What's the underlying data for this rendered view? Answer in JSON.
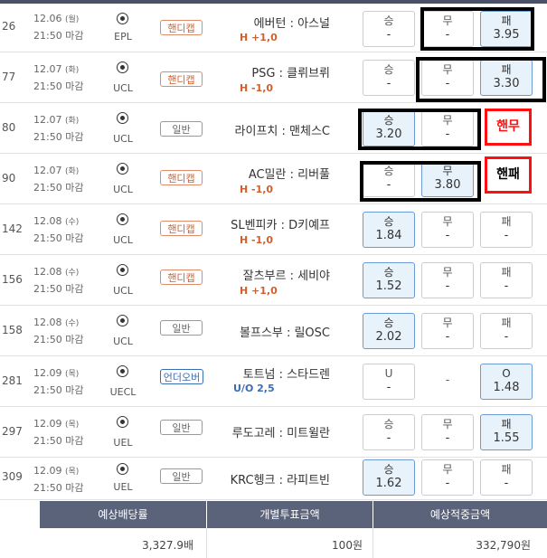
{
  "rows": [
    {
      "num": "26",
      "date": "12.06",
      "day": "(월)",
      "time": "21:50 마감",
      "league": "EPL",
      "type": "핸디캡",
      "match": "에버턴 : 아스널",
      "sub": "H +1,0",
      "odds": [
        {
          "label": "승",
          "value": "-"
        },
        {
          "label": "무",
          "value": "-"
        },
        {
          "label": "패",
          "value": "3.95"
        }
      ]
    },
    {
      "num": "77",
      "date": "12.07",
      "day": "(화)",
      "time": "21:50 마감",
      "league": "UCL",
      "type": "핸디캡",
      "match": "PSG : 클뤼브뤼",
      "sub": "H -1,0",
      "odds": [
        {
          "label": "승",
          "value": "-"
        },
        {
          "label": "무",
          "value": "-"
        },
        {
          "label": "패",
          "value": "3.30"
        }
      ]
    },
    {
      "num": "80",
      "date": "12.07",
      "day": "(화)",
      "time": "21:50 마감",
      "league": "UCL",
      "type": "일반",
      "match": "라이프치 : 맨체스C",
      "sub": "",
      "odds": [
        {
          "label": "승",
          "value": "3.20"
        },
        {
          "label": "무",
          "value": "-"
        }
      ],
      "note": "핸무"
    },
    {
      "num": "90",
      "date": "12.07",
      "day": "(화)",
      "time": "21:50 마감",
      "league": "UCL",
      "type": "핸디캡",
      "match": "AC밀란 : 리버풀",
      "sub": "H -1,0",
      "odds": [
        {
          "label": "승",
          "value": "-"
        },
        {
          "label": "무",
          "value": "3.80"
        }
      ],
      "note": "핸패"
    },
    {
      "num": "142",
      "date": "12.08",
      "day": "(수)",
      "time": "21:50 마감",
      "league": "UCL",
      "type": "핸디캡",
      "match": "SL벤피카 : D키예프",
      "sub": "H -1,0",
      "odds": [
        {
          "label": "승",
          "value": "1.84"
        },
        {
          "label": "무",
          "value": "-"
        },
        {
          "label": "패",
          "value": "-"
        }
      ]
    },
    {
      "num": "156",
      "date": "12.08",
      "day": "(수)",
      "time": "21:50 마감",
      "league": "UCL",
      "type": "핸디캡",
      "match": "잘츠부르 : 세비야",
      "sub": "H +1,0",
      "odds": [
        {
          "label": "승",
          "value": "1.52"
        },
        {
          "label": "무",
          "value": "-"
        },
        {
          "label": "패",
          "value": "-"
        }
      ]
    },
    {
      "num": "158",
      "date": "12.08",
      "day": "(수)",
      "time": "21:50 마감",
      "league": "UCL",
      "type": "일반",
      "match": "볼프스부 : 릴OSC",
      "sub": "",
      "odds": [
        {
          "label": "승",
          "value": "2.02"
        },
        {
          "label": "무",
          "value": "-"
        },
        {
          "label": "패",
          "value": "-"
        }
      ]
    },
    {
      "num": "281",
      "date": "12.09",
      "day": "(목)",
      "time": "21:50 마감",
      "league": "UECL",
      "type": "언더오버",
      "match": "토트넘 : 스타드렌",
      "sub": "U/O 2,5",
      "odds": [
        {
          "label": "U",
          "value": "-"
        },
        {
          "label": "-",
          "value": ""
        },
        {
          "label": "O",
          "value": "1.48"
        }
      ]
    },
    {
      "num": "297",
      "date": "12.09",
      "day": "(목)",
      "time": "21:50 마감",
      "league": "UEL",
      "type": "일반",
      "match": "루도고레 : 미트윌란",
      "sub": "",
      "odds": [
        {
          "label": "승",
          "value": "-"
        },
        {
          "label": "무",
          "value": "-"
        },
        {
          "label": "패",
          "value": "1.55"
        }
      ]
    },
    {
      "num": "309",
      "date": "12.09",
      "day": "(목)",
      "time": "21:50 마감",
      "league": "UEL",
      "type": "일반",
      "match": "KRC헹크 : 라피트빈",
      "sub": "",
      "odds": [
        {
          "label": "승",
          "value": "1.62"
        },
        {
          "label": "무",
          "value": "-"
        },
        {
          "label": "패",
          "value": "-"
        }
      ]
    }
  ],
  "summary": {
    "headers": [
      "예상배당률",
      "개별투표금액",
      "예상적중금액"
    ],
    "values": [
      "3,327.9배",
      "100원",
      "332,790원"
    ]
  }
}
